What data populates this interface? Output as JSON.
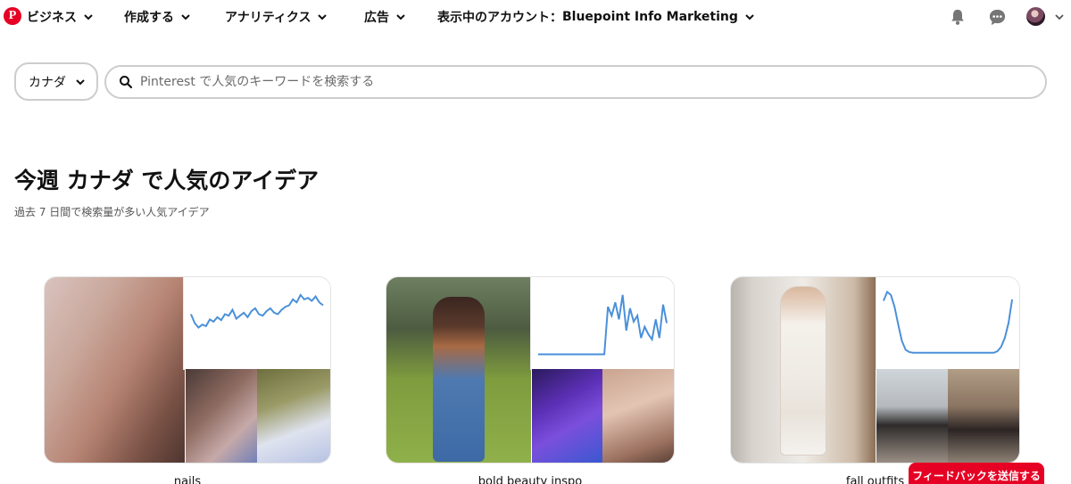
{
  "nav": {
    "logo": "P",
    "business": "ビジネス",
    "create": "作成する",
    "analytics": "アナリティクス",
    "ads": "広告",
    "account_prefix": "表示中のアカウント：",
    "account_name": "Bluepoint Info Marketing"
  },
  "search": {
    "country": "カナダ",
    "placeholder": "Pinterest で人気のキーワードを検索する"
  },
  "heading": {
    "title": "今週 カナダ で人気のアイデア",
    "subtitle": "過去 7 日間で検索量が多い人気アイデア"
  },
  "cards": [
    {
      "title": "nails",
      "trend": [
        0.62,
        0.5,
        0.44,
        0.48,
        0.46,
        0.55,
        0.52,
        0.58,
        0.54,
        0.62,
        0.6,
        0.68,
        0.56,
        0.6,
        0.64,
        0.58,
        0.66,
        0.7,
        0.62,
        0.6,
        0.66,
        0.7,
        0.64,
        0.62,
        0.68,
        0.72,
        0.74,
        0.82,
        0.78,
        0.88,
        0.82,
        0.84,
        0.8,
        0.86,
        0.78,
        0.74
      ]
    },
    {
      "title": "bold beauty inspo",
      "trend": [
        0.08,
        0.08,
        0.08,
        0.08,
        0.08,
        0.08,
        0.08,
        0.08,
        0.08,
        0.08,
        0.08,
        0.08,
        0.08,
        0.08,
        0.08,
        0.08,
        0.08,
        0.08,
        0.08,
        0.72,
        0.6,
        0.78,
        0.55,
        0.88,
        0.4,
        0.7,
        0.52,
        0.6,
        0.3,
        0.45,
        0.35,
        0.28,
        0.55,
        0.3,
        0.75,
        0.5
      ]
    },
    {
      "title": "fall outfits",
      "trend": [
        0.8,
        0.92,
        0.88,
        0.72,
        0.48,
        0.26,
        0.14,
        0.11,
        0.1,
        0.1,
        0.1,
        0.1,
        0.1,
        0.1,
        0.1,
        0.1,
        0.1,
        0.1,
        0.1,
        0.1,
        0.1,
        0.1,
        0.1,
        0.1,
        0.1,
        0.1,
        0.1,
        0.1,
        0.1,
        0.1,
        0.1,
        0.12,
        0.18,
        0.3,
        0.5,
        0.82
      ]
    }
  ],
  "feedback_label": "フィードバックを送信する",
  "colors": {
    "brand": "#e60023",
    "trend_line": "#4a90d9"
  }
}
